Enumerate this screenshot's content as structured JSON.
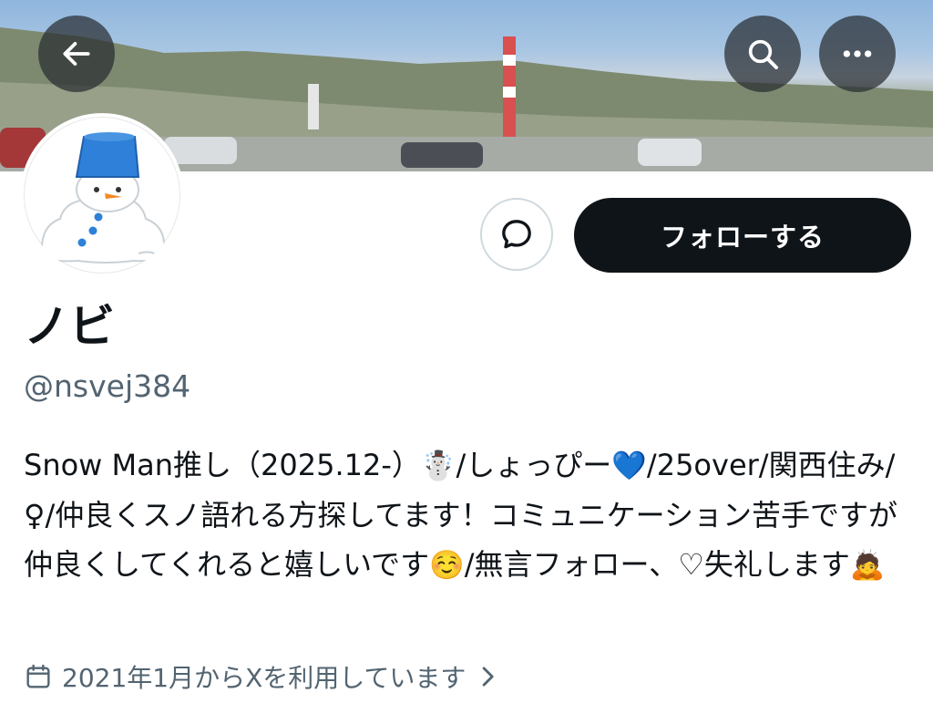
{
  "banner": {
    "back_icon": "arrow-left-icon",
    "search_icon": "search-icon",
    "more_icon": "more-horizontal-icon"
  },
  "profile": {
    "avatar_icon": "snowman-avatar",
    "message_icon": "chat-bubble-icon",
    "follow_label": "フォローする",
    "display_name": "ノビ",
    "handle": "@nsvej384",
    "bio": {
      "part1": "Snow Man推し（2025.12-）",
      "emoji1": "☃️",
      "part2": "/しょっぴー",
      "emoji2": "💙",
      "part3": "/25over/関西住み/♀/仲良くスノ語れる方探してます！コミュニケーション苦手ですが仲良くしてくれると嬉しいです",
      "emoji3": "☺️",
      "part4": "/無言フォロー、♡失礼します",
      "emoji4": "🙇"
    },
    "joined_icon": "calendar-icon",
    "joined_text": "2021年1月からXを利用しています",
    "joined_chevron_icon": "chevron-right-icon"
  },
  "colors": {
    "text": "#0f1419",
    "secondary": "#536471",
    "follow_bg": "#0f1419",
    "bucket_blue": "#2f80d8"
  }
}
